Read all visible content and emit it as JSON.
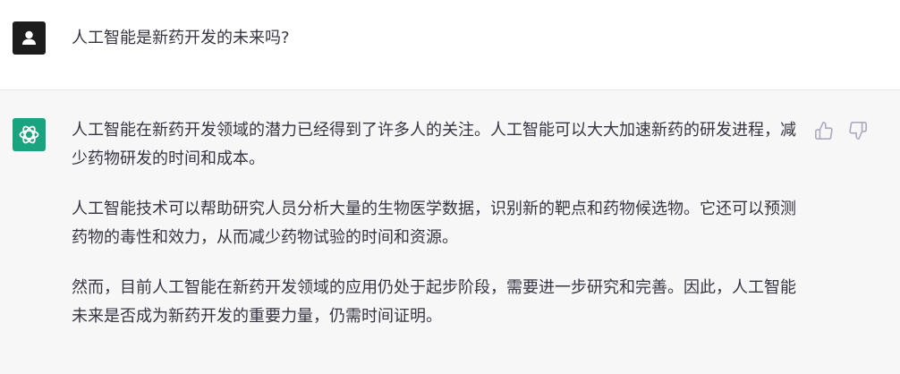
{
  "user": {
    "avatar_icon": "user-silhouette-icon",
    "message": "人工智能是新药开发的未来吗?"
  },
  "assistant": {
    "avatar_icon": "openai-logo-icon",
    "accent_color": "#19a37f",
    "paragraphs": [
      "人工智能在新药开发领域的潜力已经得到了许多人的关注。人工智能可以大大加速新药的研发进程，减少药物研发的时间和成本。",
      "人工智能技术可以帮助研究人员分析大量的生物医学数据，识别新的靶点和药物候选物。它还可以预测药物的毒性和效力，从而减少药物试验的时间和资源。",
      "然而，目前人工智能在新药开发领域的应用仍处于起步阶段，需要进一步研究和完善。因此，人工智能未来是否成为新药开发的重要力量，仍需时间证明。"
    ],
    "feedback_icons": [
      "thumbs-up-icon",
      "thumbs-down-icon"
    ]
  }
}
